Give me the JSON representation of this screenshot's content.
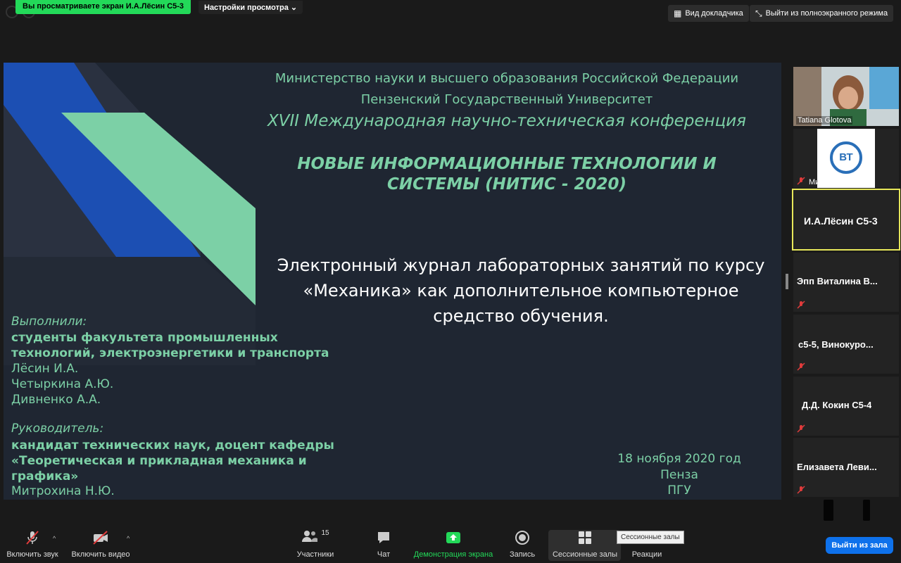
{
  "top": {
    "share_banner": "Вы просматриваете экран И.А.Лёсин С5-3",
    "view_settings": "Настройки просмотра",
    "speaker_view": "Вид докладчика",
    "exit_fullscreen": "Выйти из полноэкранного режима"
  },
  "slide": {
    "ministry": "Министерство науки и высшего образования Российской Федерации",
    "university": "Пензенский Государственный Университет",
    "conference": "XVII Международная научно-техническая конференция",
    "conference_name": "НОВЫЕ ИНФОРМАЦИОННЫЕ ТЕХНОЛОГИИ  И СИСТЕМЫ (НИТИС - 2020)",
    "topic": "Электронный журнал лабораторных занятий по курсу «Механика» как дополнительное компьютерное средство обучения.",
    "authors_label": "Выполнили:",
    "authors_desc_1": "студенты факультета промышленных",
    "authors_desc_2": "технологий, электроэнергетики и транспорта",
    "authors": [
      "Лёсин И.А.",
      "Четыркина А.Ю.",
      "Дивненко А.А."
    ],
    "supervisor_label": "Руководитель:",
    "supervisor_desc_1": "кандидат технических наук, доцент кафедры",
    "supervisor_desc_2": "«Теоретическая и прикладная механика и",
    "supervisor_desc_3": "графика»",
    "supervisor_name": "Митрохина Н.Ю.",
    "date": "18 ноября 2020 год",
    "city": "Пенза",
    "org": "ПГУ",
    "colors": {
      "bg": "#1f2632",
      "accent": "#7cd0a6",
      "blue": "#1c4fb3"
    }
  },
  "participants": [
    {
      "name": "Tatiana Glotova",
      "video": true
    },
    {
      "name": "Митрохин М...",
      "muted": true,
      "logo": "ВТ"
    },
    {
      "name": "И.А.Лёсин С5-3",
      "active": true
    },
    {
      "name": "Эпп Виталина В...",
      "muted": true
    },
    {
      "name": "с5-5,  Винокуро...",
      "muted": true
    },
    {
      "name": "Д.Д. Кокин С5-4",
      "muted": true
    },
    {
      "name": "Елизавета  Леви...",
      "muted": true
    }
  ],
  "toolbar": {
    "unmute": "Включить звук",
    "start_video": "Включить видео",
    "participants": "Участники",
    "participants_count": "15",
    "chat": "Чат",
    "share_screen": "Демонстрация экрана",
    "record": "Запись",
    "breakout_rooms": "Сессионные залы",
    "reactions": "Реакции",
    "tooltip": "Сессионные залы",
    "leave": "Выйти из зала"
  }
}
